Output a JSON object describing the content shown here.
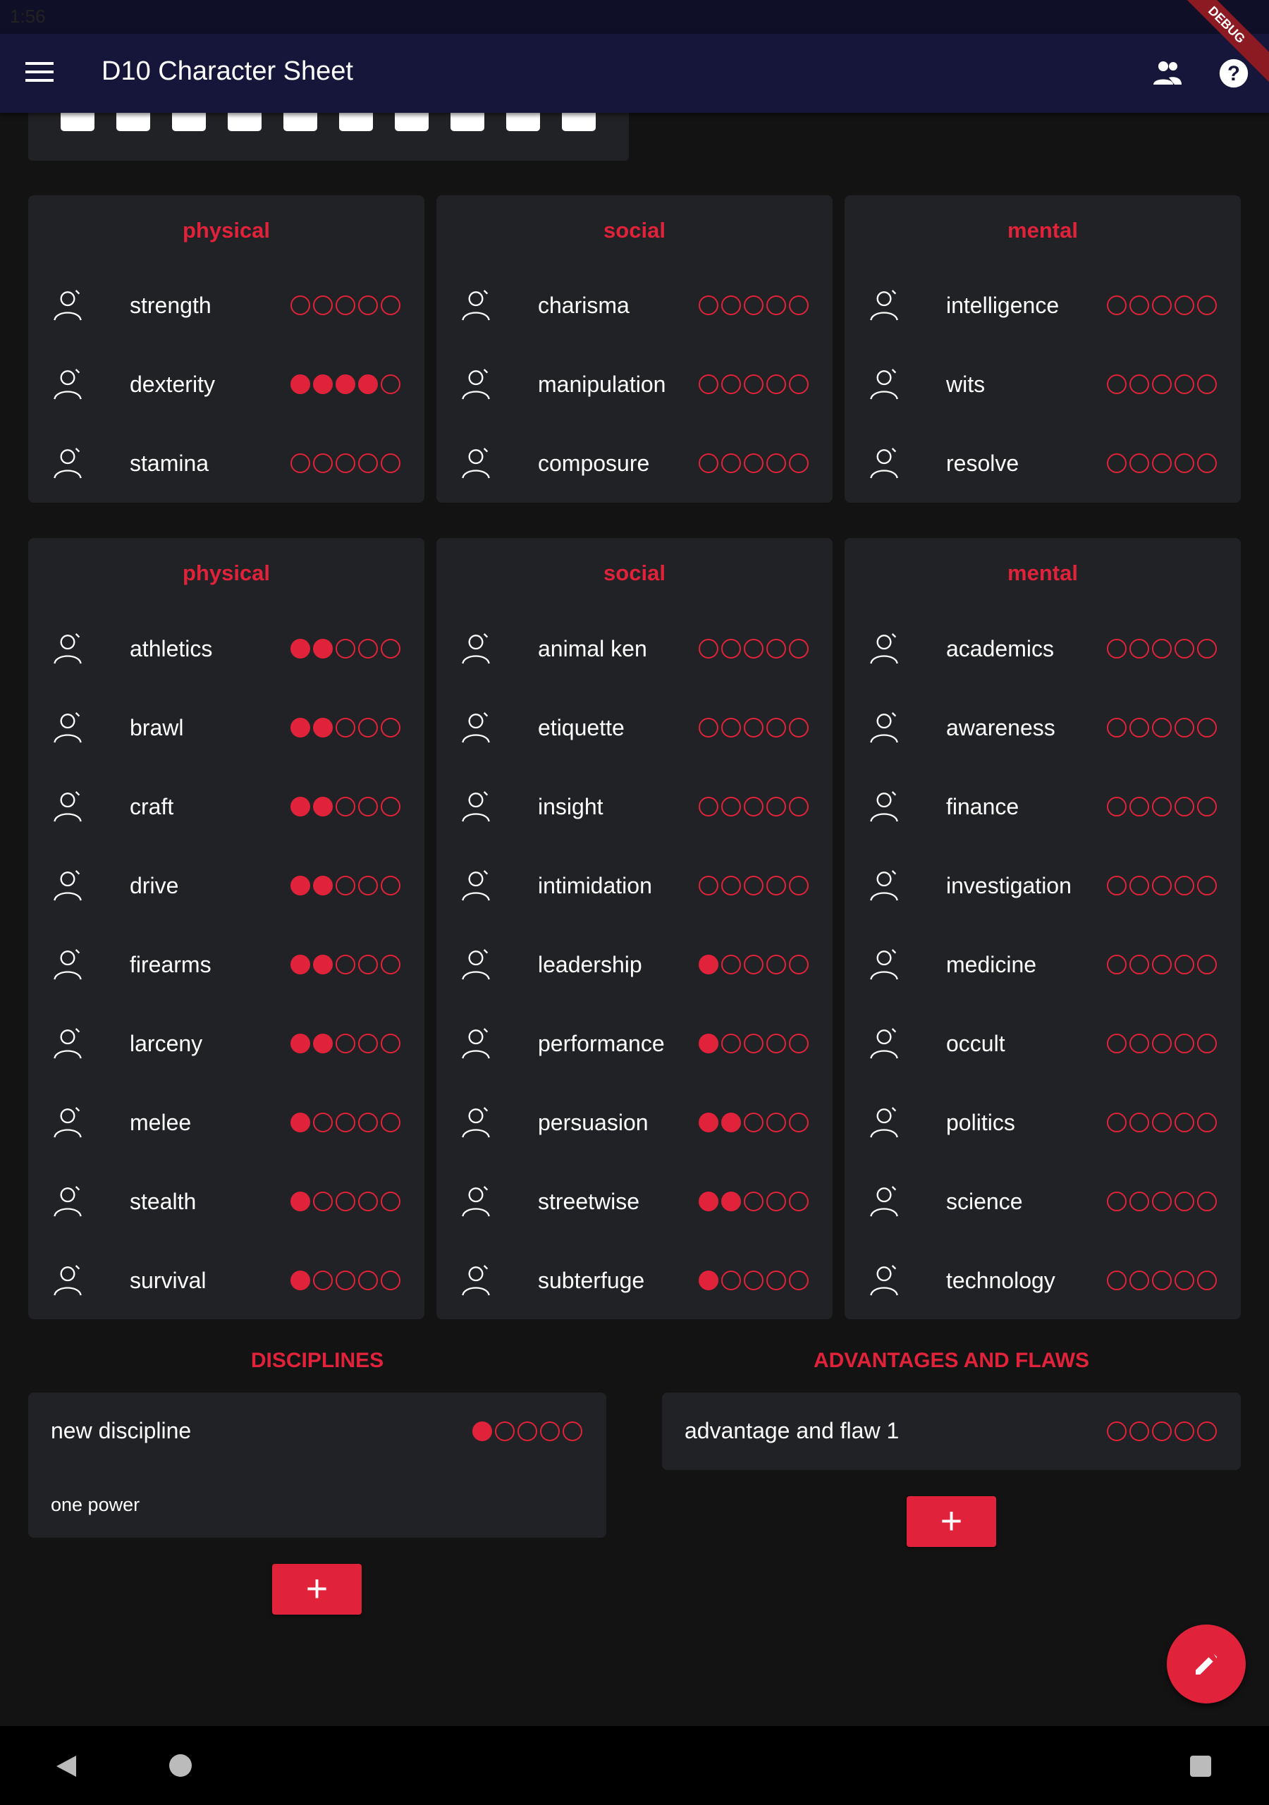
{
  "status_bar": {
    "time": "1:56"
  },
  "app_bar": {
    "title": "D10 Character Sheet",
    "debug_banner": "DEBUG"
  },
  "colors": {
    "accent": "#e0223a",
    "background": "#131313",
    "card": "#212225",
    "app_bar": "#16163a"
  },
  "attributes": [
    {
      "title": "physical",
      "items": [
        {
          "label": "strength",
          "value": 0,
          "icon": "flexed-arm-icon"
        },
        {
          "label": "dexterity",
          "value": 4,
          "icon": "running-person-icon"
        },
        {
          "label": "stamina",
          "value": 0,
          "icon": "strongman-icon"
        }
      ]
    },
    {
      "title": "social",
      "items": [
        {
          "label": "charisma",
          "value": 0,
          "icon": "suit-icon"
        },
        {
          "label": "manipulation",
          "value": 0,
          "icon": "puppet-icon"
        },
        {
          "label": "composure",
          "value": 0,
          "icon": "hand-leaf-icon"
        }
      ]
    },
    {
      "title": "mental",
      "items": [
        {
          "label": "intelligence",
          "value": 0,
          "icon": "brain-icon"
        },
        {
          "label": "wits",
          "value": 0,
          "icon": "lightbulb-icon"
        },
        {
          "label": "resolve",
          "value": 0,
          "icon": "meditation-icon"
        }
      ]
    }
  ],
  "skills": [
    {
      "title": "physical",
      "items": [
        {
          "label": "athletics",
          "value": 2,
          "icon": "athlete-icon"
        },
        {
          "label": "brawl",
          "value": 2,
          "icon": "fight-icon"
        },
        {
          "label": "craft",
          "value": 2,
          "icon": "tools-icon"
        },
        {
          "label": "drive",
          "value": 2,
          "icon": "steering-wheel-icon"
        },
        {
          "label": "firearms",
          "value": 2,
          "icon": "gun-icon"
        },
        {
          "label": "larceny",
          "value": 2,
          "icon": "thief-icon"
        },
        {
          "label": "melee",
          "value": 1,
          "icon": "fist-icon"
        },
        {
          "label": "stealth",
          "value": 1,
          "icon": "mask-icon"
        },
        {
          "label": "survival",
          "value": 1,
          "icon": "campfire-icon"
        }
      ]
    },
    {
      "title": "social",
      "items": [
        {
          "label": "animal ken",
          "value": 0,
          "icon": "paw-icon"
        },
        {
          "label": "etiquette",
          "value": 0,
          "icon": "conversation-icon"
        },
        {
          "label": "insight",
          "value": 0,
          "icon": "eye-icon"
        },
        {
          "label": "intimidation",
          "value": 0,
          "icon": "intimidation-icon"
        },
        {
          "label": "leadership",
          "value": 1,
          "icon": "group-icon"
        },
        {
          "label": "performance",
          "value": 1,
          "icon": "microphone-icon"
        },
        {
          "label": "persuasion",
          "value": 2,
          "icon": "persuasion-icon"
        },
        {
          "label": "streetwise",
          "value": 2,
          "icon": "street-icon"
        },
        {
          "label": "subterfuge",
          "value": 1,
          "icon": "spy-icon"
        }
      ]
    },
    {
      "title": "mental",
      "items": [
        {
          "label": "academics",
          "value": 0,
          "icon": "graduation-cap-icon"
        },
        {
          "label": "awareness",
          "value": 0,
          "icon": "hand-idea-icon"
        },
        {
          "label": "finance",
          "value": 0,
          "icon": "money-hand-icon"
        },
        {
          "label": "investigation",
          "value": 0,
          "icon": "magnifier-icon"
        },
        {
          "label": "medicine",
          "value": 0,
          "icon": "medicine-icon"
        },
        {
          "label": "occult",
          "value": 0,
          "icon": "occult-eye-icon"
        },
        {
          "label": "politics",
          "value": 0,
          "icon": "scales-icon"
        },
        {
          "label": "science",
          "value": 0,
          "icon": "flask-icon"
        },
        {
          "label": "technology",
          "value": 0,
          "icon": "computer-icon"
        }
      ]
    }
  ],
  "disciplines": {
    "heading": "DISCIPLINES",
    "items": [
      {
        "name": "new discipline",
        "value": 1,
        "power": "one power"
      }
    ],
    "add_label": "+"
  },
  "advantages": {
    "heading": "ADVANTAGES AND FLAWS",
    "items": [
      {
        "name": "advantage and flaw 1",
        "value": 0
      }
    ],
    "add_label": "+"
  },
  "max_dots": 5
}
